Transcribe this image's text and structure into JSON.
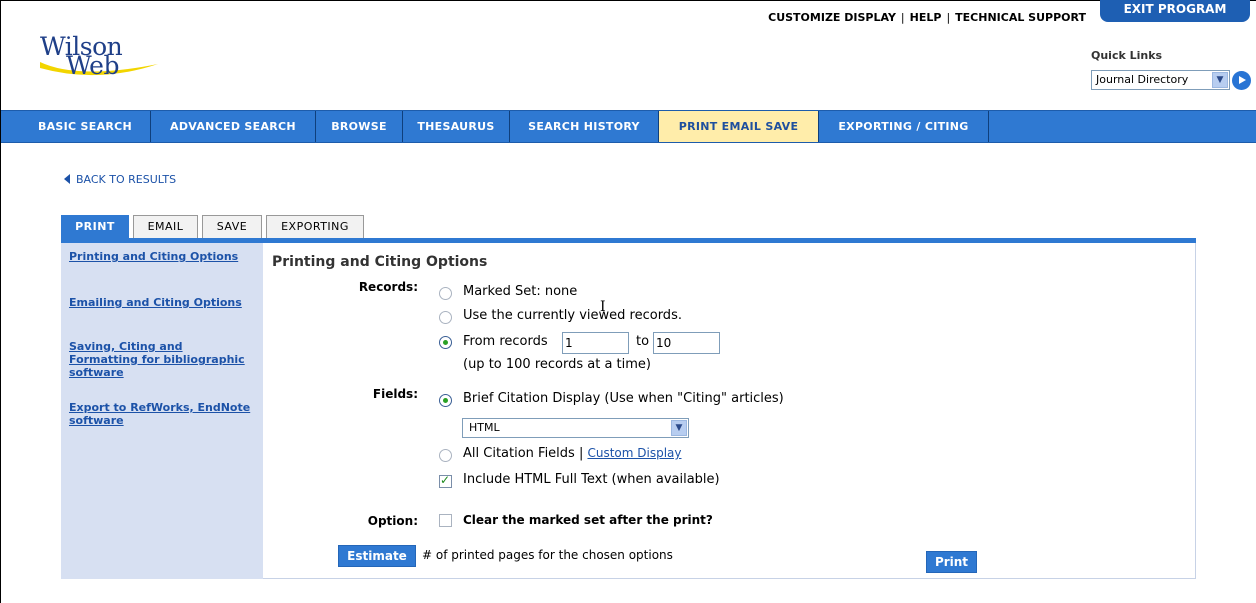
{
  "header": {
    "logo_line1": "Wilson",
    "logo_line2": "Web",
    "top_links": [
      "CUSTOMIZE DISPLAY",
      "HELP",
      "TECHNICAL SUPPORT"
    ],
    "exit_label": "EXIT PROGRAM",
    "quick_links_label": "Quick Links",
    "quick_links_selected": "Journal Directory"
  },
  "nav": {
    "items": [
      "BASIC SEARCH",
      "ADVANCED SEARCH",
      "BROWSE",
      "THESAURUS",
      "SEARCH HISTORY",
      "PRINT EMAIL SAVE",
      "EXPORTING / CITING"
    ],
    "active": "PRINT EMAIL SAVE"
  },
  "back_link": "BACK TO RESULTS",
  "tabs": [
    "PRINT",
    "EMAIL",
    "SAVE",
    "EXPORTING"
  ],
  "sidebar": {
    "links": [
      "Printing and Citing Options",
      "Emailing and Citing Options",
      "Saving, Citing and Formatting for bibliographic software",
      "Export to RefWorks, EndNote software"
    ]
  },
  "form": {
    "title": "Printing and Citing Options",
    "records_label": "Records:",
    "records_opt1": "Marked Set: none",
    "records_opt2": "Use the currently viewed records.",
    "records_opt3": "From records",
    "from_value": "1",
    "to_label": "to",
    "to_value": "10",
    "limit_note": "(up to 100 records at a time)",
    "fields_label": "Fields:",
    "fields_opt1": "Brief Citation Display (Use when \"Citing\" articles)",
    "format_selected": "HTML",
    "fields_opt2": "All Citation Fields |",
    "custom_display": "Custom Display",
    "include_fulltext": "Include HTML Full Text (when available)",
    "option_label": "Option:",
    "clear_marked": "Clear the marked set after the print?",
    "estimate_label": "Estimate",
    "estimate_note": "# of printed pages for the chosen options",
    "print_label": "Print"
  },
  "colors": {
    "nav_blue": "#2f79d2",
    "active_tab_bg": "#ffedaa",
    "sidebar_bg": "#d7e0f2",
    "link_blue": "#1c52a8"
  }
}
